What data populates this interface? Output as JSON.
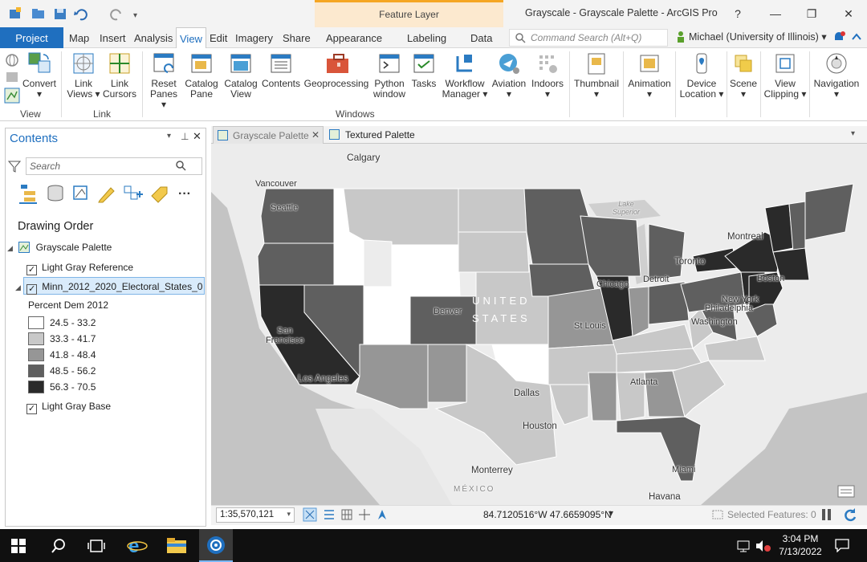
{
  "titlebar": {
    "feature_layer_label": "Feature Layer",
    "window_title": "Grayscale - Grayscale Palette - ArcGIS Pro",
    "help": "?",
    "minimize": "—",
    "maximize": "❐",
    "close": "✕"
  },
  "tabs": {
    "project": "Project",
    "map": "Map",
    "insert": "Insert",
    "analysis": "Analysis",
    "view": "View",
    "edit": "Edit",
    "imagery": "Imagery",
    "share": "Share",
    "appearance": "Appearance",
    "labeling": "Labeling",
    "data": "Data"
  },
  "command_search": {
    "placeholder": "Command Search (Alt+Q)"
  },
  "user": {
    "name": "Michael (University of Illinois)"
  },
  "ribbon": {
    "convert": "Convert",
    "link_views": "Link\nViews",
    "link_cursors": "Link\nCursors",
    "reset_panes": "Reset\nPanes",
    "catalog_pane": "Catalog\nPane",
    "catalog_view": "Catalog\nView",
    "contents": "Contents",
    "geoprocessing": "Geoprocessing",
    "python_window": "Python\nwindow",
    "tasks": "Tasks",
    "workflow_manager": "Workflow\nManager",
    "aviation": "Aviation",
    "indoors": "Indoors",
    "thumbnail": "Thumbnail",
    "animation": "Animation",
    "device_location": "Device\nLocation",
    "scene": "Scene",
    "view_clipping": "View\nClipping",
    "navigation": "Navigation",
    "groups": {
      "view": "View",
      "link": "Link",
      "windows": "Windows"
    }
  },
  "contents_pane": {
    "title": "Contents",
    "search_placeholder": "Search",
    "drawing_order": "Drawing Order",
    "map_name": "Grayscale Palette",
    "layers": [
      {
        "name": "Light Gray Reference",
        "checked": true
      },
      {
        "name": "Minn_2012_2020_Electoral_States_0",
        "checked": true
      },
      {
        "name": "Light Gray Base",
        "checked": true
      }
    ],
    "legend_title": "Percent Dem 2012",
    "legend": [
      {
        "label": "24.5 - 33.2",
        "color": "#ffffff"
      },
      {
        "label": "33.3 - 41.7",
        "color": "#c8c8c8"
      },
      {
        "label": "41.8 - 48.4",
        "color": "#969696"
      },
      {
        "label": "48.5 - 56.2",
        "color": "#5f5f5f"
      },
      {
        "label": "56.3 - 70.5",
        "color": "#2a2a2a"
      }
    ]
  },
  "map_tabs": [
    {
      "label": "Grayscale Palette",
      "active": true
    },
    {
      "label": "Textured Palette",
      "active": false
    }
  ],
  "map_labels": {
    "calgary": "Calgary",
    "vancouver": "Vancouver",
    "seattle": "Seattle",
    "lake_superior": "Lake\nSuperior",
    "montreal": "Montreal",
    "toronto": "Toronto",
    "detroit": "Detroit",
    "chicago": "Chicago",
    "boston": "Boston",
    "new_york": "New York",
    "philadelphia": "Philadelphia",
    "washington": "Washington",
    "united_states": "UNITED\nSTATES",
    "denver": "Denver",
    "st_louis": "St Louis",
    "san_francisco": "San\nFrancisco",
    "los_angeles": "Los Angeles",
    "atlanta": "Atlanta",
    "dallas": "Dallas",
    "houston": "Houston",
    "monterrey": "Monterrey",
    "mexico": "MÉXICO",
    "miami": "Miami",
    "havana": "Havana"
  },
  "status": {
    "scale": "1:35,570,121",
    "coords": "84.7120516°W 47.6659095°N",
    "selected": "Selected Features: 0"
  },
  "taskbar": {
    "time": "3:04 PM",
    "date": "7/13/2022"
  }
}
